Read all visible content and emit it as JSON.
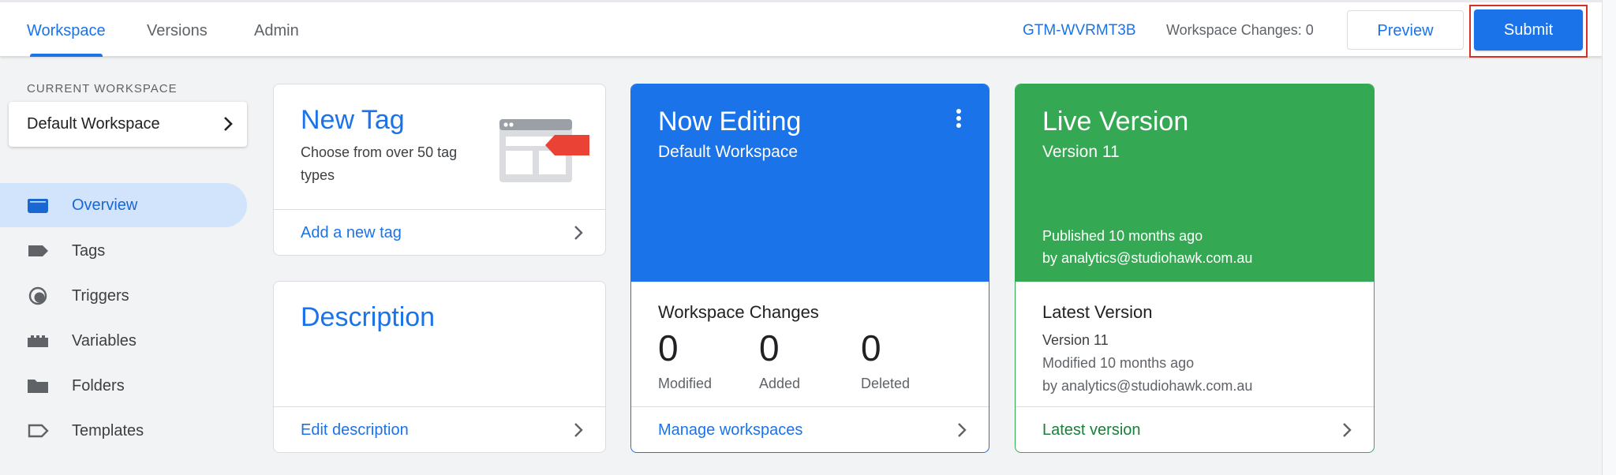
{
  "header": {
    "tabs": [
      {
        "label": "Workspace"
      },
      {
        "label": "Versions"
      },
      {
        "label": "Admin"
      }
    ],
    "container_id": "GTM-WVRMT3B",
    "workspace_changes_label": "Workspace Changes: 0",
    "preview_label": "Preview",
    "submit_label": "Submit"
  },
  "sidebar": {
    "current_workspace_label": "CURRENT WORKSPACE",
    "workspace_name": "Default Workspace",
    "items": [
      {
        "label": "Overview",
        "icon": "overview-icon"
      },
      {
        "label": "Tags",
        "icon": "tag-icon"
      },
      {
        "label": "Triggers",
        "icon": "trigger-icon"
      },
      {
        "label": "Variables",
        "icon": "variables-icon"
      },
      {
        "label": "Folders",
        "icon": "folder-icon"
      },
      {
        "label": "Templates",
        "icon": "template-icon"
      }
    ]
  },
  "new_tag_card": {
    "title": "New Tag",
    "description": "Choose from over 50 tag types",
    "link": "Add a new tag"
  },
  "description_card": {
    "title": "Description",
    "link": "Edit description"
  },
  "now_editing_card": {
    "title": "Now Editing",
    "subtitle": "Default Workspace",
    "changes_heading": "Workspace Changes",
    "stats": [
      {
        "value": "0",
        "label": "Modified"
      },
      {
        "value": "0",
        "label": "Added"
      },
      {
        "value": "0",
        "label": "Deleted"
      }
    ],
    "link": "Manage workspaces"
  },
  "live_version_card": {
    "title": "Live Version",
    "subtitle": "Version 11",
    "published": "Published 10 months ago",
    "published_by": "by analytics@studiohawk.com.au",
    "latest_heading": "Latest Version",
    "latest_version": "Version 11",
    "latest_modified": "Modified 10 months ago",
    "latest_by": "by analytics@studiohawk.com.au",
    "link": "Latest version"
  },
  "colors": {
    "accent": "#1a73e8",
    "now_editing_bg": "#1a73e8",
    "live_version_bg": "#34a853",
    "live_link": "#188038",
    "submit_highlight": "#d93025"
  }
}
